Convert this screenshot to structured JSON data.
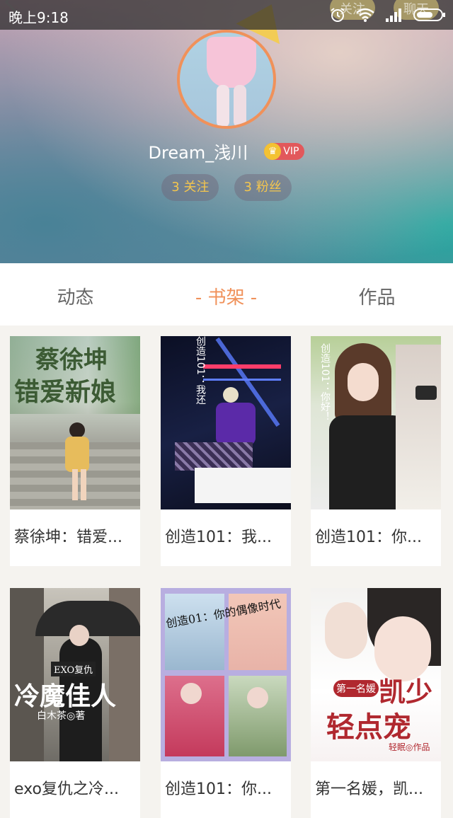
{
  "status_bar": {
    "time": "晚上9:18"
  },
  "header": {
    "left_button": "关注",
    "right_button": "聊天",
    "username": "Dream_浅川",
    "vip_label": "VIP",
    "following": "3 关注",
    "followers": "3 粉丝"
  },
  "tabs": [
    {
      "label": "动态"
    },
    {
      "label": "- 书架 -"
    },
    {
      "label": "作品"
    }
  ],
  "books": [
    {
      "title": "蔡徐坤：错爱...",
      "cover_line1": "蔡徐坤",
      "cover_line2": "错爱新娘"
    },
    {
      "title": "创造101：我...",
      "cover_vertical": "创造101：我还"
    },
    {
      "title": "创造101：你...",
      "cover_vertical": "创造101：你好！"
    },
    {
      "title": "exo复仇之冷...",
      "cover_small": "EXO复仇",
      "cover_line1": "冷魔佳人",
      "cover_author": "白木茶◎著"
    },
    {
      "title": "创造101：你...",
      "cover_line1": "创造01：你的偶像时代"
    },
    {
      "title": "第一名媛，凯...",
      "cover_small": "第一名媛",
      "cover_line1": "凯少",
      "cover_line2": "轻点宠",
      "cover_author": "轻眠◎作品"
    }
  ]
}
